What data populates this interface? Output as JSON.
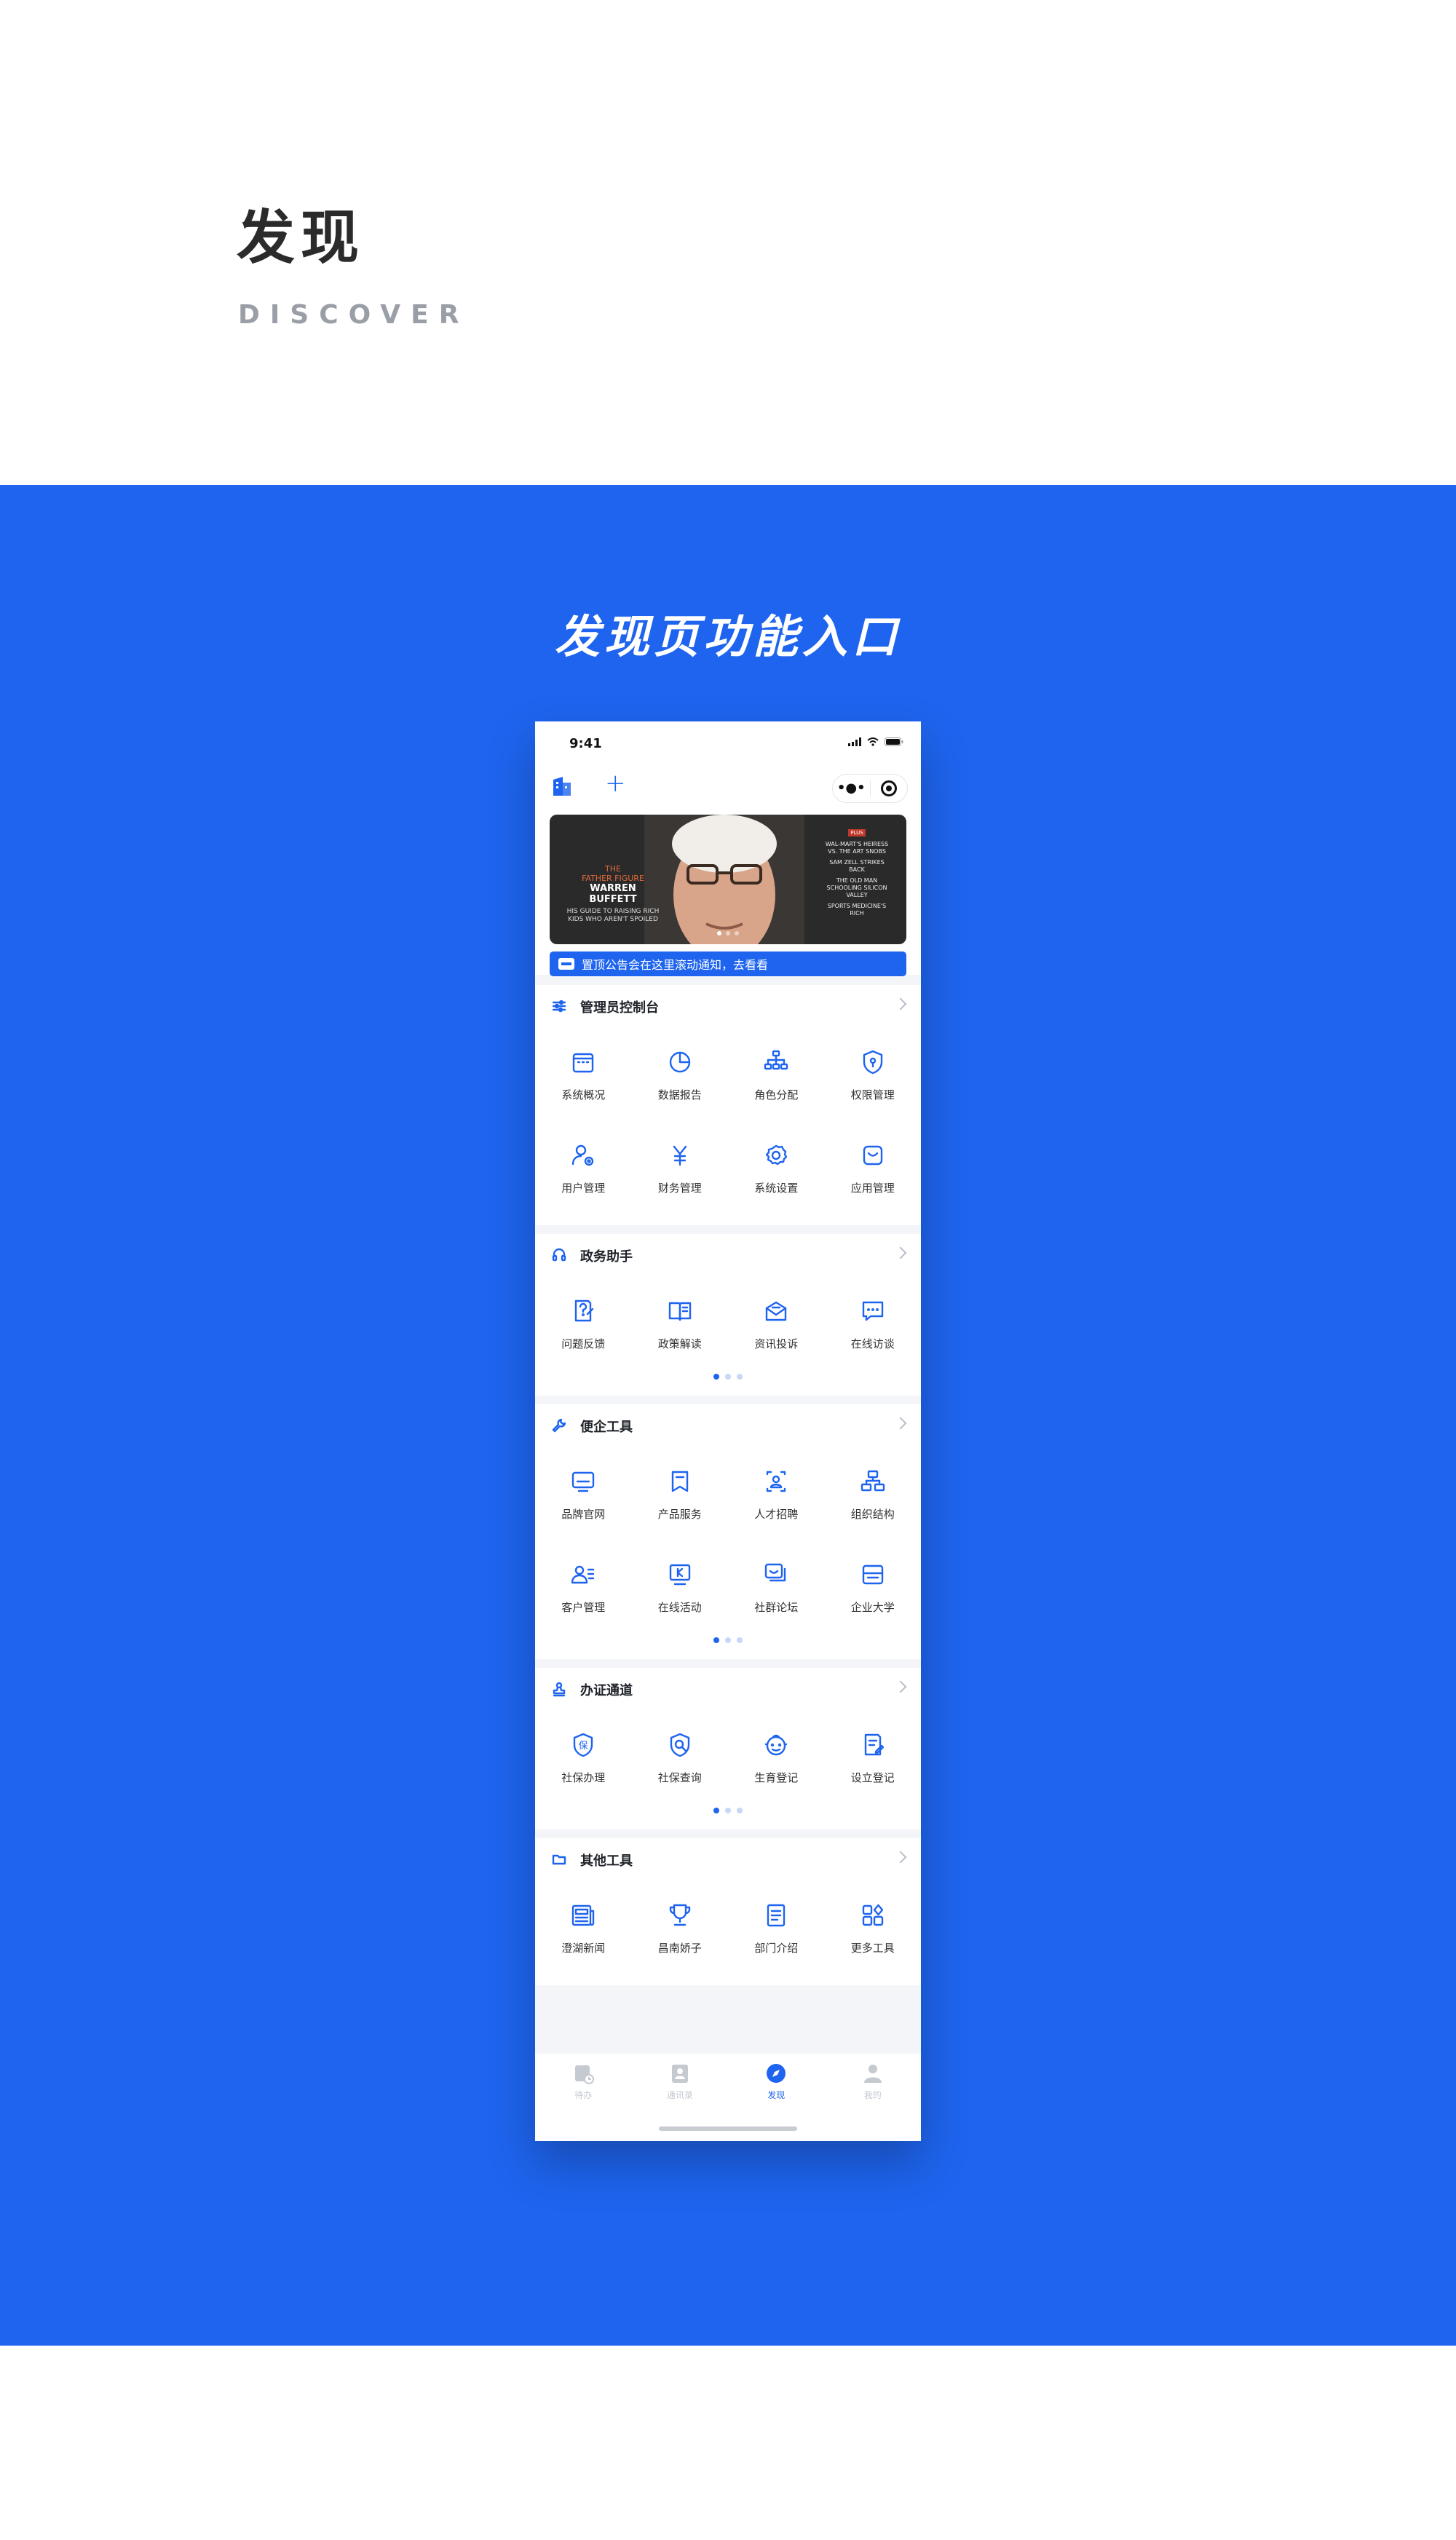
{
  "hero": {
    "title": "发现",
    "subtitle": "DISCOVER"
  },
  "section_title": "发现页功能入口",
  "status_bar": {
    "time": "9:41"
  },
  "banner": {
    "left_line1": "THE",
    "left_line2": "FATHER FIGURE",
    "left_line3": "WARREN",
    "left_line4": "BUFFETT",
    "left_line5": "HIS GUIDE TO RAISING RICH KIDS WHO AREN'T SPOILED",
    "right_tag": "PLUS",
    "right_p1": "WAL-MART'S HEIRESS VS. THE ART SNOBS",
    "right_p2": "SAM ZELL STRIKES BACK",
    "right_p3": "THE OLD MAN SCHOOLING SILICON VALLEY",
    "right_p4": "SPORTS MEDICINE'S RICH"
  },
  "notice": {
    "text": "置顶公告会在这里滚动通知，去看看"
  },
  "sections": [
    {
      "title": "管理员控制台",
      "icon": "sliders-icon",
      "items": [
        {
          "label": "系统概况",
          "icon": "calendar-icon"
        },
        {
          "label": "数据报告",
          "icon": "pie-chart-icon"
        },
        {
          "label": "角色分配",
          "icon": "org-tree-icon"
        },
        {
          "label": "权限管理",
          "icon": "shield-icon"
        },
        {
          "label": "用户管理",
          "icon": "user-settings-icon"
        },
        {
          "label": "财务管理",
          "icon": "yuan-icon"
        },
        {
          "label": "系统设置",
          "icon": "gear-icon"
        },
        {
          "label": "应用管理",
          "icon": "app-icon"
        }
      ]
    },
    {
      "title": "政务助手",
      "icon": "headset-icon",
      "items": [
        {
          "label": "问题反馈",
          "icon": "question-doc-icon"
        },
        {
          "label": "政策解读",
          "icon": "book-icon"
        },
        {
          "label": "资讯投诉",
          "icon": "mail-icon"
        },
        {
          "label": "在线访谈",
          "icon": "chat-icon"
        }
      ]
    },
    {
      "title": "便企工具",
      "icon": "wrench-icon",
      "items": [
        {
          "label": "品牌官网",
          "icon": "monitor-icon"
        },
        {
          "label": "产品服务",
          "icon": "bookmark-icon"
        },
        {
          "label": "人才招聘",
          "icon": "id-badge-icon"
        },
        {
          "label": "组织结构",
          "icon": "structure-icon"
        },
        {
          "label": "客户管理",
          "icon": "user-list-icon"
        },
        {
          "label": "在线活动",
          "icon": "screen-k-icon"
        },
        {
          "label": "社群论坛",
          "icon": "forum-icon"
        },
        {
          "label": "企业大学",
          "icon": "window-icon"
        }
      ]
    },
    {
      "title": "办证通道",
      "icon": "stamp-icon",
      "items": [
        {
          "label": "社保办理",
          "icon": "shield-bao-icon"
        },
        {
          "label": "社保查询",
          "icon": "shield-search-icon"
        },
        {
          "label": "生育登记",
          "icon": "baby-icon"
        },
        {
          "label": "设立登记",
          "icon": "doc-edit-icon"
        }
      ]
    },
    {
      "title": "其他工具",
      "icon": "folder-icon",
      "items": [
        {
          "label": "澄湖新闻",
          "icon": "news-icon"
        },
        {
          "label": "昌南娇子",
          "icon": "trophy-icon"
        },
        {
          "label": "部门介绍",
          "icon": "list-doc-icon"
        },
        {
          "label": "更多工具",
          "icon": "grid-plus-icon"
        }
      ]
    }
  ],
  "tabbar": [
    {
      "label": "待办",
      "icon": "todo-icon",
      "active": false
    },
    {
      "label": "通讯录",
      "icon": "contacts-icon",
      "active": false
    },
    {
      "label": "发现",
      "icon": "compass-icon",
      "active": true
    },
    {
      "label": "我的",
      "icon": "person-icon",
      "active": false
    }
  ],
  "colors": {
    "brand": "#1e64ee",
    "background_light": "#f3f5f8"
  }
}
